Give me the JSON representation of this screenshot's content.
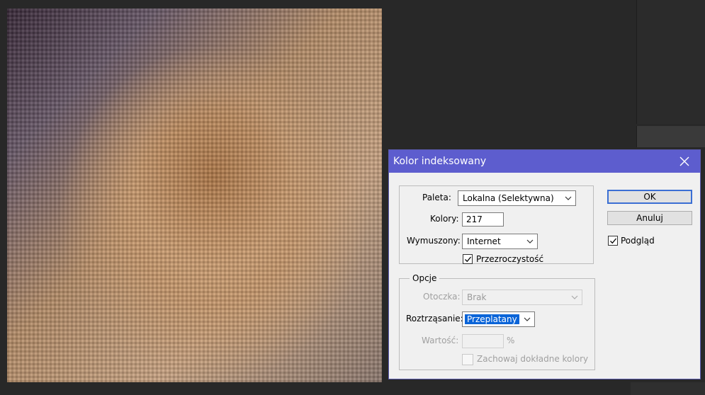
{
  "dialog": {
    "title": "Kolor indeksowany",
    "palette_group": {
      "palette_label": "Paleta:",
      "palette_value": "Lokalna (Selektywna)",
      "colors_label": "Kolory:",
      "colors_value": "217",
      "forced_label": "Wymuszony:",
      "forced_value": "Internet",
      "transparency_label": "Przezroczystość",
      "transparency_checked": true
    },
    "options_group": {
      "legend": "Opcje",
      "matte_label": "Otoczka:",
      "matte_value": "Brak",
      "dither_label": "Roztrząsanie:",
      "dither_value": "Przeplatany",
      "amount_label": "Wartość:",
      "amount_value": "",
      "amount_unit": "%",
      "preserve_label": "Zachowaj dokładne kolory",
      "preserve_checked": false
    },
    "buttons": {
      "ok": "OK",
      "cancel": "Anuluj"
    },
    "preview_label": "Podgląd",
    "preview_checked": true
  },
  "colors": {
    "titlebar": "#5d5dce",
    "workspace": "#282828",
    "dialog_bg": "#f0f0f0",
    "selection": "#0a64d8"
  }
}
